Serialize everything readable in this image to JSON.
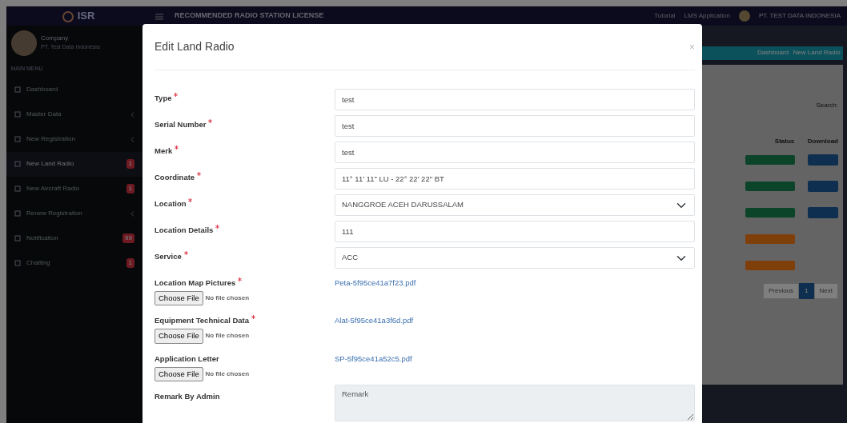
{
  "navbar": {
    "logo": "ISR",
    "title": "RECOMMENDED RADIO STATION LICENSE",
    "links": [
      "Tutorial",
      "LMS Application"
    ],
    "user": "PT. TEST DATA INDONESIA"
  },
  "sidebar": {
    "user": {
      "name": "Company",
      "sub": "PT. Test Data Indonesia"
    },
    "heading": "MAIN MENU",
    "items": [
      {
        "label": "Dashboard",
        "selected": false,
        "caret": false
      },
      {
        "label": "Master Data",
        "selected": false,
        "caret": true
      },
      {
        "label": "New Registration",
        "selected": false,
        "caret": true
      },
      {
        "label": "New Land Radio",
        "selected": true,
        "badge": "1",
        "caret": false
      },
      {
        "label": "New Aircraft Radio",
        "selected": false,
        "badge": "1",
        "caret": false
      },
      {
        "label": "Renew Registration",
        "selected": false,
        "caret": true
      },
      {
        "label": "Notification",
        "selected": false,
        "badge": "99",
        "caret": false
      },
      {
        "label": "Chatting",
        "selected": false,
        "badge": "1",
        "caret": false
      }
    ]
  },
  "breadcrumb": [
    "Dashboard",
    "New Land Radio"
  ],
  "search_label": "Search:",
  "table": {
    "columns": [
      "Status",
      "Download"
    ],
    "rows": [
      {
        "color": "#0c442a",
        "download": true
      },
      {
        "color": "#0c442a",
        "download": true
      },
      {
        "color": "#0c442a",
        "download": true
      },
      {
        "color": "#7f3f0a",
        "download": false
      },
      {
        "color": "#7f3f0a",
        "download": false
      }
    ]
  },
  "pagination": [
    {
      "label": "Previous",
      "selected": false
    },
    {
      "label": "1",
      "selected": true
    },
    {
      "label": "Next",
      "selected": false
    }
  ],
  "modal": {
    "title": "Edit Land Radio",
    "close": "×",
    "fields": [
      {
        "kind": "text",
        "label": "Type",
        "required": true,
        "value": "test"
      },
      {
        "kind": "text",
        "label": "Serial Number",
        "required": true,
        "value": "test"
      },
      {
        "kind": "text",
        "label": "Merk",
        "required": true,
        "value": "test"
      },
      {
        "kind": "text",
        "label": "Coordinate",
        "required": true,
        "value": "11° 11' 11\" LU - 22° 22' 22\" BT"
      },
      {
        "kind": "select",
        "label": "Location",
        "required": true,
        "value": "NANGGROE ACEH DARUSSALAM"
      },
      {
        "kind": "text",
        "label": "Location Details",
        "required": true,
        "value": "111"
      },
      {
        "kind": "select",
        "label": "Service",
        "required": true,
        "value": "ACC"
      },
      {
        "kind": "file",
        "label": "Location Map Pictures",
        "required": true,
        "button": "Choose File",
        "status": "No file chosen",
        "link": "Peta-5f95ce41a7f23.pdf"
      },
      {
        "kind": "file",
        "label": "Equipment Technical Data",
        "required": true,
        "button": "Choose File",
        "status": "No file chosen",
        "link": "Alat-5f95ce41a3f6d.pdf"
      },
      {
        "kind": "file",
        "label": "Application Letter",
        "required": false,
        "button": "Choose File",
        "status": "No file chosen",
        "link": "SP-5f95ce41a52c5.pdf"
      },
      {
        "kind": "textarea",
        "label": "Remark By Admin",
        "required": false,
        "placeholder": "Remark"
      }
    ]
  }
}
